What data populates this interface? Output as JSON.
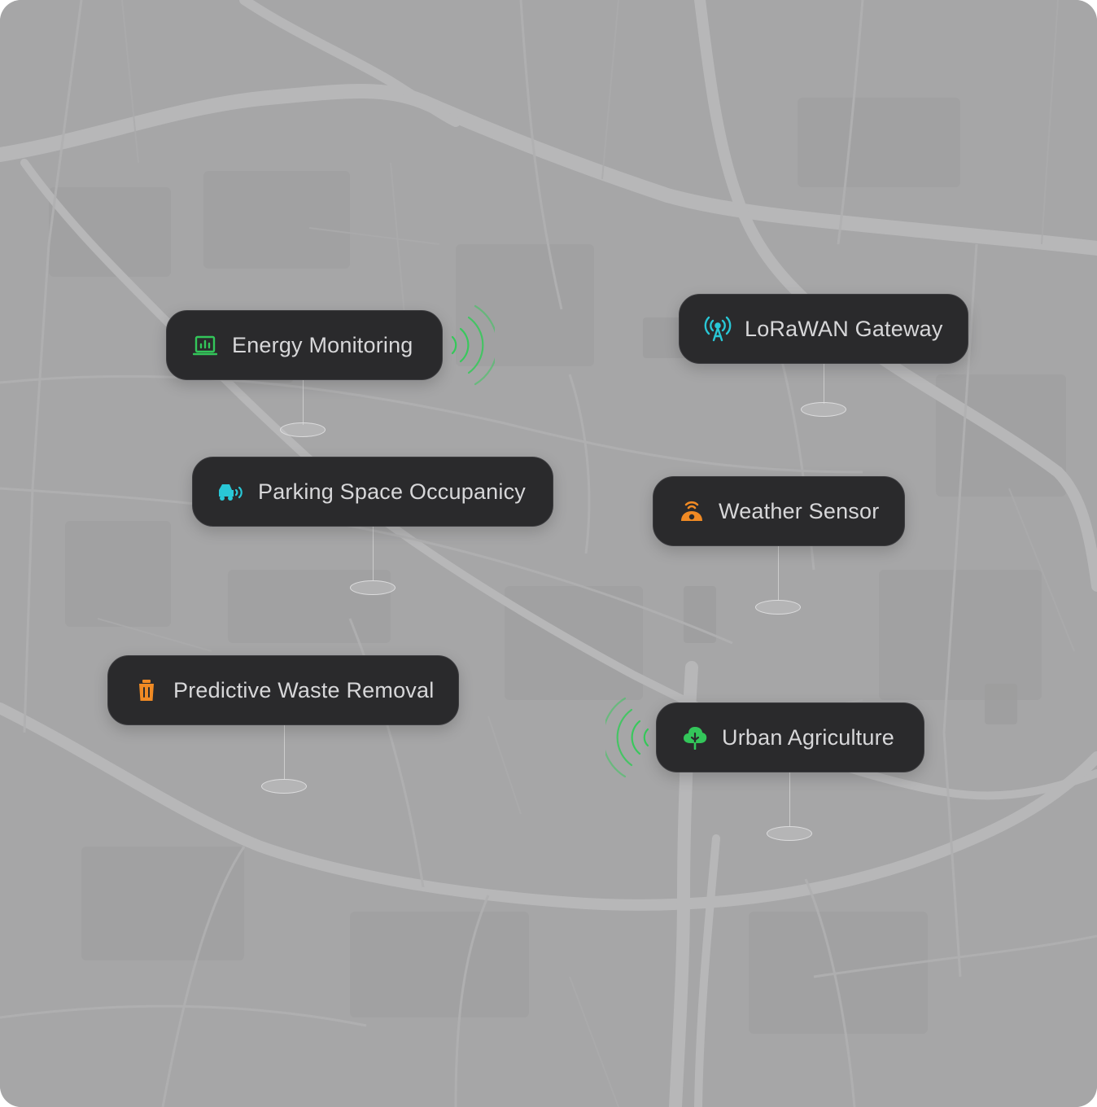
{
  "colors": {
    "map_background": "#a6a6a7",
    "road": "#b9b9ba",
    "pill_background": "#2a2a2c",
    "pill_text": "#d7d7d9",
    "signal_green": "#2ecc55",
    "cyan": "#29c7d6",
    "orange": "#f08a24",
    "green": "#33c65a"
  },
  "markers": [
    {
      "label": "Energy Monitoring",
      "icon": "energy-chart-icon",
      "icon_color": "#33c65a",
      "signal": "right"
    },
    {
      "label": "LoRaWAN Gateway",
      "icon": "antenna-icon",
      "icon_color": "#29c7d6"
    },
    {
      "label": "Parking Space Occupanicy",
      "icon": "car-sensor-icon",
      "icon_color": "#29c7d6"
    },
    {
      "label": "Weather Sensor",
      "icon": "weather-sensor-icon",
      "icon_color": "#f08a24"
    },
    {
      "label": "Predictive Waste Removal",
      "icon": "trash-bin-icon",
      "icon_color": "#f08a24"
    },
    {
      "label": "Urban Agriculture",
      "icon": "tree-icon",
      "icon_color": "#33c65a",
      "signal": "left"
    }
  ]
}
